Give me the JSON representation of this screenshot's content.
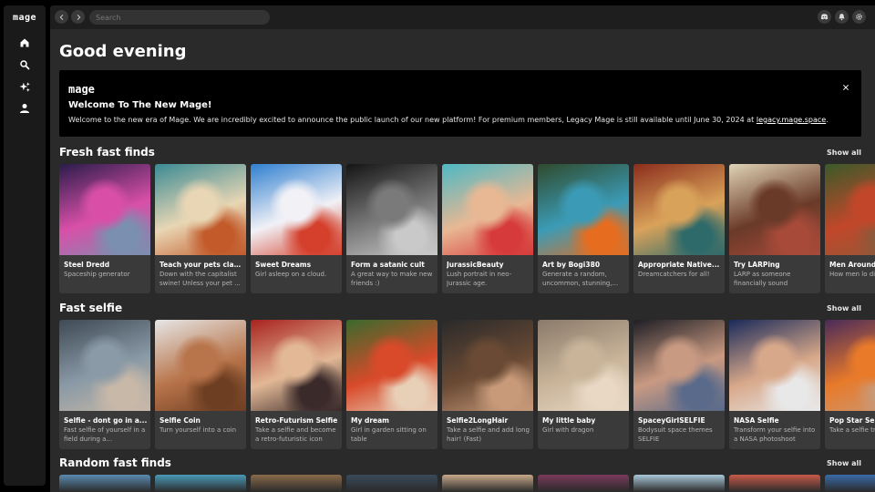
{
  "app": {
    "logo": "mage"
  },
  "topbar": {
    "search_placeholder": "Search"
  },
  "greeting": "Good evening",
  "banner": {
    "logo": "mage",
    "title": "Welcome To The New Mage!",
    "text": "Welcome to the new era of Mage. We are incredibly excited to announce the public launch of our new platform! For premium members, Legacy Mage is still available until June 30, 2024 at ",
    "link": "legacy.mage.space",
    "text_end": "."
  },
  "sections": [
    {
      "title": "Fresh fast finds",
      "show_all": "Show all",
      "cards": [
        {
          "title": "Steel Dredd",
          "desc": "Spaceship generator",
          "colors": [
            "#2a1c4a",
            "#d94fa8",
            "#7b8fb0"
          ]
        },
        {
          "title": "Teach your pets clas...",
          "desc": "Down with the capitalist swine! Unless your pet ...",
          "colors": [
            "#3a8a94",
            "#e8d6b4",
            "#c25a2a"
          ]
        },
        {
          "title": "Sweet Dreams",
          "desc": "Girl asleep on a cloud.",
          "colors": [
            "#2f7fd0",
            "#f1f1f6",
            "#d4402c"
          ]
        },
        {
          "title": "Form a satanic cult",
          "desc": "A great way to make new friends :)",
          "colors": [
            "#141414",
            "#7a7a7a",
            "#c9c9c9"
          ]
        },
        {
          "title": "JurassicBeauty",
          "desc": "Lush portrait in neo-Jurassic age.",
          "colors": [
            "#4db8c4",
            "#e8b894",
            "#d63a3a"
          ]
        },
        {
          "title": "Art by Bogi380",
          "desc": "Generate a random, uncommon, stunning,...",
          "colors": [
            "#2f4a2c",
            "#3b9bb6",
            "#e66d1f"
          ]
        },
        {
          "title": "Appropriate Native...",
          "desc": "Dreamcatchers for all!",
          "colors": [
            "#8b2d1c",
            "#d9a25a",
            "#2f6a6a"
          ]
        },
        {
          "title": "Try LARPing",
          "desc": "LARP as someone financially sound",
          "colors": [
            "#e0d4b6",
            "#6a3a28",
            "#a84a3a"
          ]
        },
        {
          "title": "Men Around",
          "desc": "How men lo different nat",
          "colors": [
            "#3a5a2a",
            "#c2472a",
            "#8a5a3a"
          ]
        }
      ]
    },
    {
      "title": "Fast selfie",
      "show_all": "Show all",
      "cards": [
        {
          "title": "Selfie - dont go in a...",
          "desc": "Fast selfie of yourself in a field during a...",
          "colors": [
            "#3e4a56",
            "#8a9aa6",
            "#c8b8a8"
          ]
        },
        {
          "title": "Selfie Coin",
          "desc": "Turn yourself into a coin",
          "colors": [
            "#e6e6e6",
            "#b8744a",
            "#6e3e22"
          ]
        },
        {
          "title": "Retro-Futurism Selfie",
          "desc": "Take a selfie and become a retro-futuristic icon",
          "colors": [
            "#a8221e",
            "#e2b896",
            "#3a2a2a"
          ]
        },
        {
          "title": "My dream",
          "desc": "Girl in garden sitting on table",
          "colors": [
            "#3a6a2c",
            "#d84a2a",
            "#e8d0b8"
          ]
        },
        {
          "title": "Selfie2LongHair",
          "desc": "Take a selfie and add long hair! (Fast)",
          "colors": [
            "#2a2a2a",
            "#6a4a34",
            "#c89a7a"
          ]
        },
        {
          "title": "My little baby",
          "desc": "Girl with dragon",
          "colors": [
            "#8a7a6a",
            "#c9b49a",
            "#e8d8c4"
          ]
        },
        {
          "title": "SpaceyGirlSELFIE",
          "desc": "Bodysuit space themes SELFIE",
          "colors": [
            "#1e1e24",
            "#c99a82",
            "#5a6a8a"
          ]
        },
        {
          "title": "NASA Selfie",
          "desc": "Transform your selfie into a NASA photoshoot",
          "colors": [
            "#1a2a5a",
            "#d8a88a",
            "#e8e8e8"
          ]
        },
        {
          "title": "Pop Star Se",
          "desc": "Take a selfie transform yo",
          "colors": [
            "#4a2a5a",
            "#e87a2a",
            "#c89a7a"
          ]
        }
      ]
    },
    {
      "title": "Random fast finds",
      "show_all": "Show all",
      "thumbs": [
        "#5a8ab0",
        "#4a9ab8",
        "#8a6a4a",
        "#3a4a5a",
        "#c8a88a",
        "#7a3a5a",
        "#a8c8d8",
        "#c85a4a",
        "#3a6aa8"
      ]
    }
  ],
  "colors": {
    "sidebar": "#1a1a1a",
    "main": "#2a2a2a",
    "card": "#3a3a3a",
    "banner": "#000000"
  }
}
